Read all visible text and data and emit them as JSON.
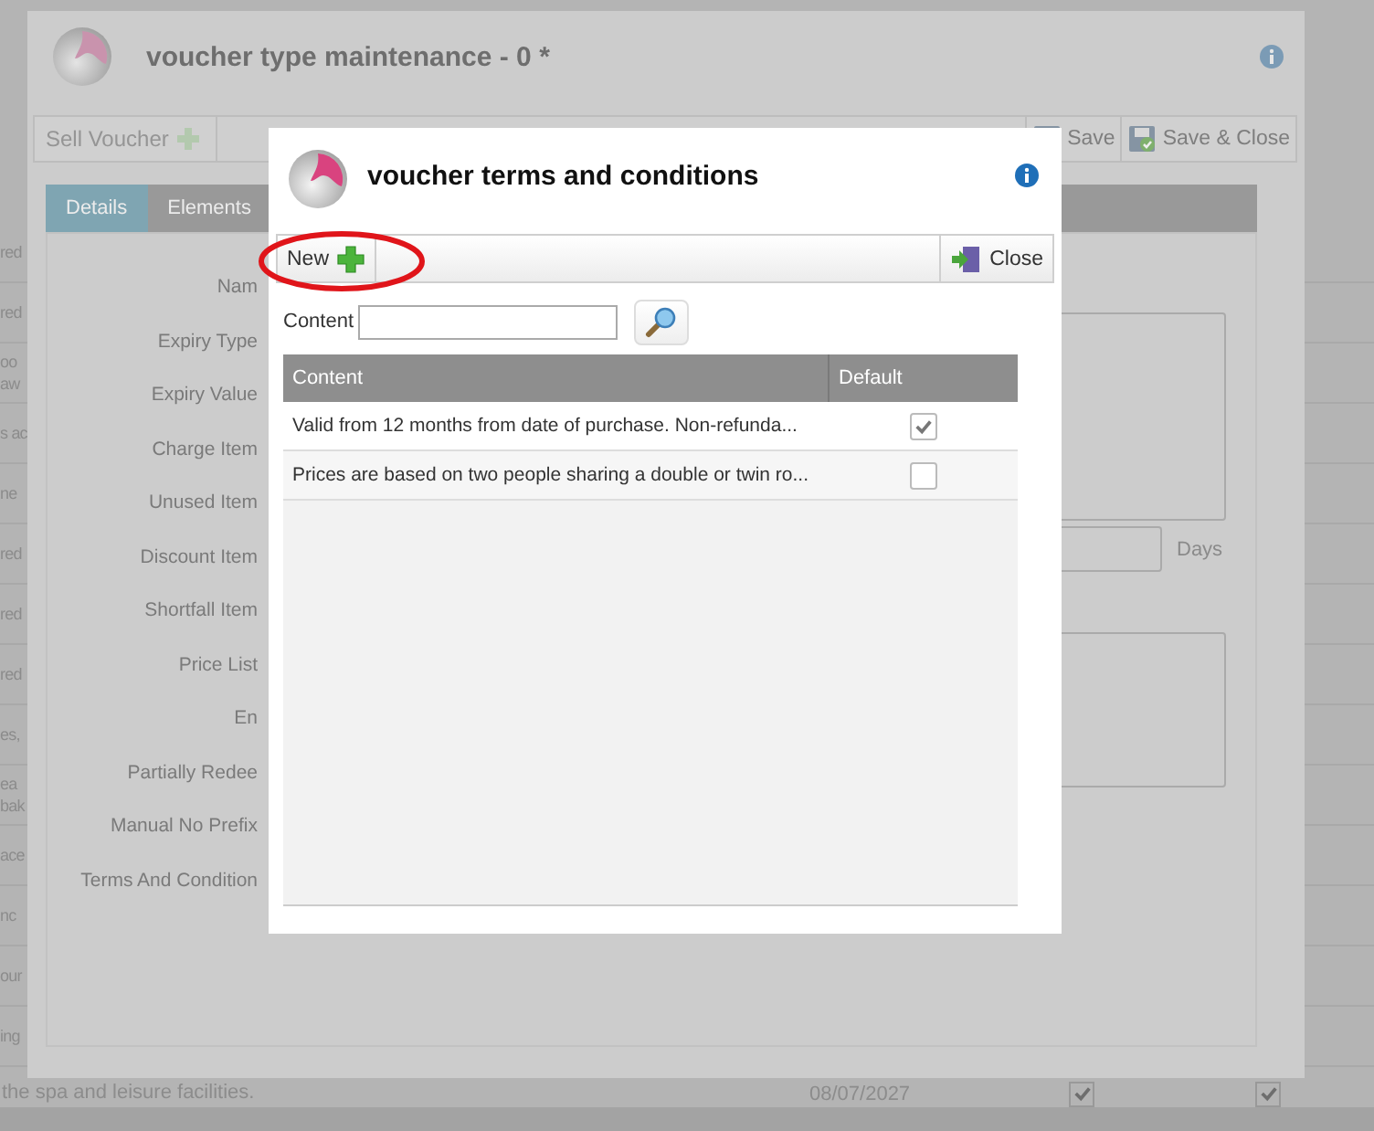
{
  "background": {
    "rows": [
      {
        "lines": [
          "red"
        ]
      },
      {
        "lines": [
          "red"
        ]
      },
      {
        "lines": [
          "oo",
          "aw"
        ]
      },
      {
        "lines": [
          "s ac"
        ]
      },
      {
        "lines": [
          "ne"
        ]
      },
      {
        "lines": [
          "red"
        ]
      },
      {
        "lines": [
          "red"
        ]
      },
      {
        "lines": [
          "red"
        ]
      },
      {
        "lines": [
          "es,"
        ]
      },
      {
        "lines": [
          "ea",
          "bak"
        ]
      },
      {
        "lines": [
          "ace"
        ]
      },
      {
        "lines": [
          "nc"
        ]
      },
      {
        "lines": [
          "our"
        ]
      },
      {
        "lines": [
          "ing"
        ]
      }
    ],
    "last_row": {
      "text": "the spa and leisure facilities.",
      "date": "08/07/2027",
      "checks": [
        true,
        true
      ]
    }
  },
  "window": {
    "title": "voucher type maintenance - 0 *",
    "toolbar": {
      "left": [
        {
          "label": "Sell Voucher",
          "disabled": true
        }
      ],
      "right": [
        {
          "label": "Save"
        },
        {
          "label": "Save & Close"
        }
      ]
    },
    "tabs": [
      {
        "label": "Details",
        "selected": true
      },
      {
        "label": "Elements",
        "selected": false
      }
    ],
    "form_labels": [
      "Nam",
      "Expiry Type",
      "Expiry Value",
      "Charge Item",
      "Unused Item",
      "Discount Item",
      "Shortfall Item",
      "Price List",
      "En",
      "Partially Redee",
      "Manual No Prefix",
      "Terms And Condition"
    ],
    "days_label": "Days"
  },
  "dialog": {
    "title": "voucher terms and conditions",
    "toolbar": {
      "new_button": "New",
      "close_button": "Close"
    },
    "search": {
      "label": "Content"
    },
    "grid": {
      "columns": [
        "Content",
        "Default"
      ],
      "rows": [
        {
          "content": "Valid from 12 months from date of purchase. Non-refunda...",
          "default": true
        },
        {
          "content": "Prices are based on two people sharing a double or twin ro...",
          "default": false
        }
      ]
    }
  }
}
